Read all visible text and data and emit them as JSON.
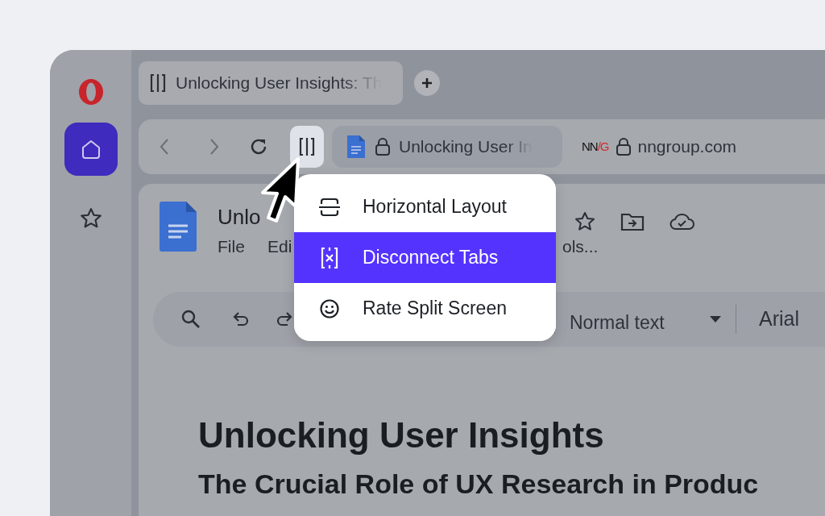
{
  "tab": {
    "title": "Unlocking User Insights: Th"
  },
  "toolbar": {
    "split_active": true,
    "address_left": "Unlocking User In",
    "site_logo": {
      "left": "NN",
      "right": "/G"
    },
    "address_right": "nngroup.com"
  },
  "sidebar": {
    "items": [
      {
        "kind": "logo",
        "selected": false
      },
      {
        "kind": "home",
        "selected": true
      },
      {
        "kind": "star",
        "selected": false
      }
    ]
  },
  "document": {
    "title": "Unlo",
    "menus": [
      "File",
      "Edi",
      "ols..."
    ],
    "style_select": "Normal text",
    "font_select": "Arial",
    "heading": "Unlocking User Insights",
    "subheading": "The Crucial Role of UX Research in Produc"
  },
  "menu": {
    "items": [
      {
        "kind": "horizontal",
        "label": "Horizontal Layout",
        "selected": false
      },
      {
        "kind": "disconnect",
        "label": "Disconnect Tabs",
        "selected": true
      },
      {
        "kind": "smile",
        "label": "Rate Split Screen",
        "selected": false
      }
    ]
  }
}
